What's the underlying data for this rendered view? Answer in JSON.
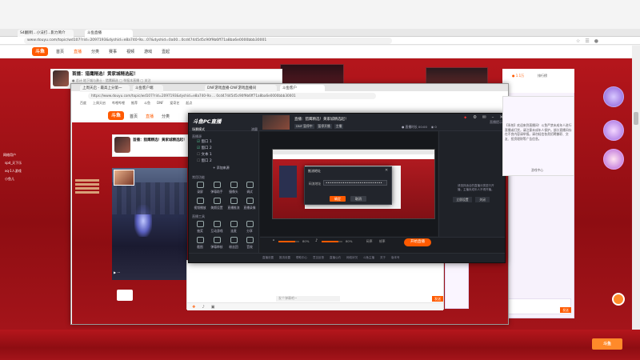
{
  "screen": {
    "accent": "#ff5a00",
    "brand_red": "#c8161d",
    "studio_bg": "#1b1d22"
  },
  "outer_browser": {
    "tabs": [
      {
        "label": "S4翻牌[...小法打...影力简介"
      },
      {
        "label": "斗鱼直播"
      }
    ],
    "address": "www.douyu.com/topic/wd107?rid=2097193&dyshid=e8a740-9a...07&dyshid=0a00...0cd47445d5c90f9b6ff71a8ba6e0000bbb30001",
    "logo": "斗鱼",
    "nav": [
      "首页",
      "直播",
      "分类",
      "赛事",
      "视频",
      "游戏",
      "壹起"
    ],
    "room_title": "首播：猎鹰精选！黄家城精选起！",
    "room_subtitle": "● 总计 地下城与勇士 · 猎鹰精选 □ 举报本直播 □ 关注",
    "rank_label": "排行榜",
    "chat_text": "【系统】欢迎来到直播间！斗鱼严禁未成年人进行直播或打赏，请注意未成年人保护。部分直播间存在不良内容请举报。请勿轻信各类招聘兼职、交友、投资理财等广告信息，谨防上当受骗。网络文明，理性消费。",
    "sidebar_users": [
      "网络用户",
      "spd_天下乐",
      "xq·1人游戏",
      "小鱼儿"
    ],
    "gift_count": "● 1.1万",
    "fans_btn": "10"
  },
  "inner_browser": {
    "tabs": [
      {
        "label": "上周天启 - 最高上分第一"
      },
      {
        "label": "斗鱼客户端"
      },
      {
        "label": "DNF游戏直播-DNF游戏直播间"
      },
      {
        "label": "斗鱼客户"
      }
    ],
    "address": "https://www.douyu.com/topic/wd107?rid=2097193&dyshid=e8a740-9a ... 0cd47445d5c90f9b6ff71a8ba6e0000bbb30001",
    "bookmarks": [
      "百度",
      "上周天启",
      "哔哩哔哩",
      "推荐",
      "斗鱼",
      "DNF",
      "爱奇艺",
      "起点"
    ],
    "logo": "斗鱼",
    "nav": [
      "首页",
      "直播",
      "分类"
    ],
    "room_title": "首播：猎鹰精选！黄家城精选起！",
    "video_bottom_left": "▶ ···",
    "chat_placeholder": "发个弹幕吧~",
    "send_label": "发送"
  },
  "studio": {
    "brand": "斗鱼PC直播",
    "room_title": "直播：猎鹰精选！黄家城精选起！",
    "room_meta": "· 总计",
    "badges": [
      "DNF 暂停中",
      "暂停开播",
      "主播"
    ],
    "top_tabs": [
      "场景模式",
      "流量"
    ],
    "scene_header": "直播源",
    "sources": [
      {
        "label": "窗口 1",
        "checked": true
      },
      {
        "label": "窗口 2",
        "checked": true
      },
      {
        "label": "文本 1",
        "checked": false
      },
      {
        "label": "窗口 2",
        "checked": false
      }
    ],
    "add_source": "+ 添加来源",
    "section1_label": "常用功能",
    "tiles_row1": [
      "录屏",
      "弹幕助手",
      "摄像头",
      "调试"
    ],
    "tiles_row2": [
      "视频播放",
      "美颜设置",
      "直播推流",
      "直播录像"
    ],
    "section2_label": "直播工具",
    "tiles_row3": [
      "抽奖",
      "互动游戏",
      "连麦",
      "分享"
    ],
    "tiles_row4": [
      "截图",
      "弹幕审核",
      "粉丝团",
      "音效"
    ],
    "more_label": "更多工具 ›",
    "live_stats": [
      "● 直播时长 00:00",
      "◉ 0"
    ],
    "audio_pct_1": "80%",
    "audio_pct_2": "80%",
    "bitrate": "码率",
    "fps": "帧率",
    "start_button": "开始直播",
    "right_panel_title": "直播提示",
    "right_panel_text": "请选择适合的直播分类进行开播，主播未成年人不得开播。",
    "right_panel_btn1": "立即设置",
    "right_panel_btn2": "关闭",
    "footer_items": [
      "直播设置",
      "推流设置",
      "帮助中心",
      "意见反馈",
      "直播公约",
      "网络状况",
      "斗鱼主播",
      "关于",
      "版本号"
    ]
  },
  "dialog": {
    "title": "推流地址",
    "field_label": "码流地址",
    "field_value": "••••••••••••••••••••••••••••••",
    "confirm": "确定",
    "cancel": "取消"
  },
  "right_browser_sidebar": {
    "chat_text": "【系统】欢迎来到直播间！斗鱼严禁未成年人进行直播或打赏，请注意未成年人保护。部分直播间存在不良内容请举报。请勿轻信各类招聘兼职、交友、投资理财等广告信息。",
    "ad_label": "游戏中心",
    "send_label": "发送"
  },
  "taskbar_note": "斗鱼"
}
